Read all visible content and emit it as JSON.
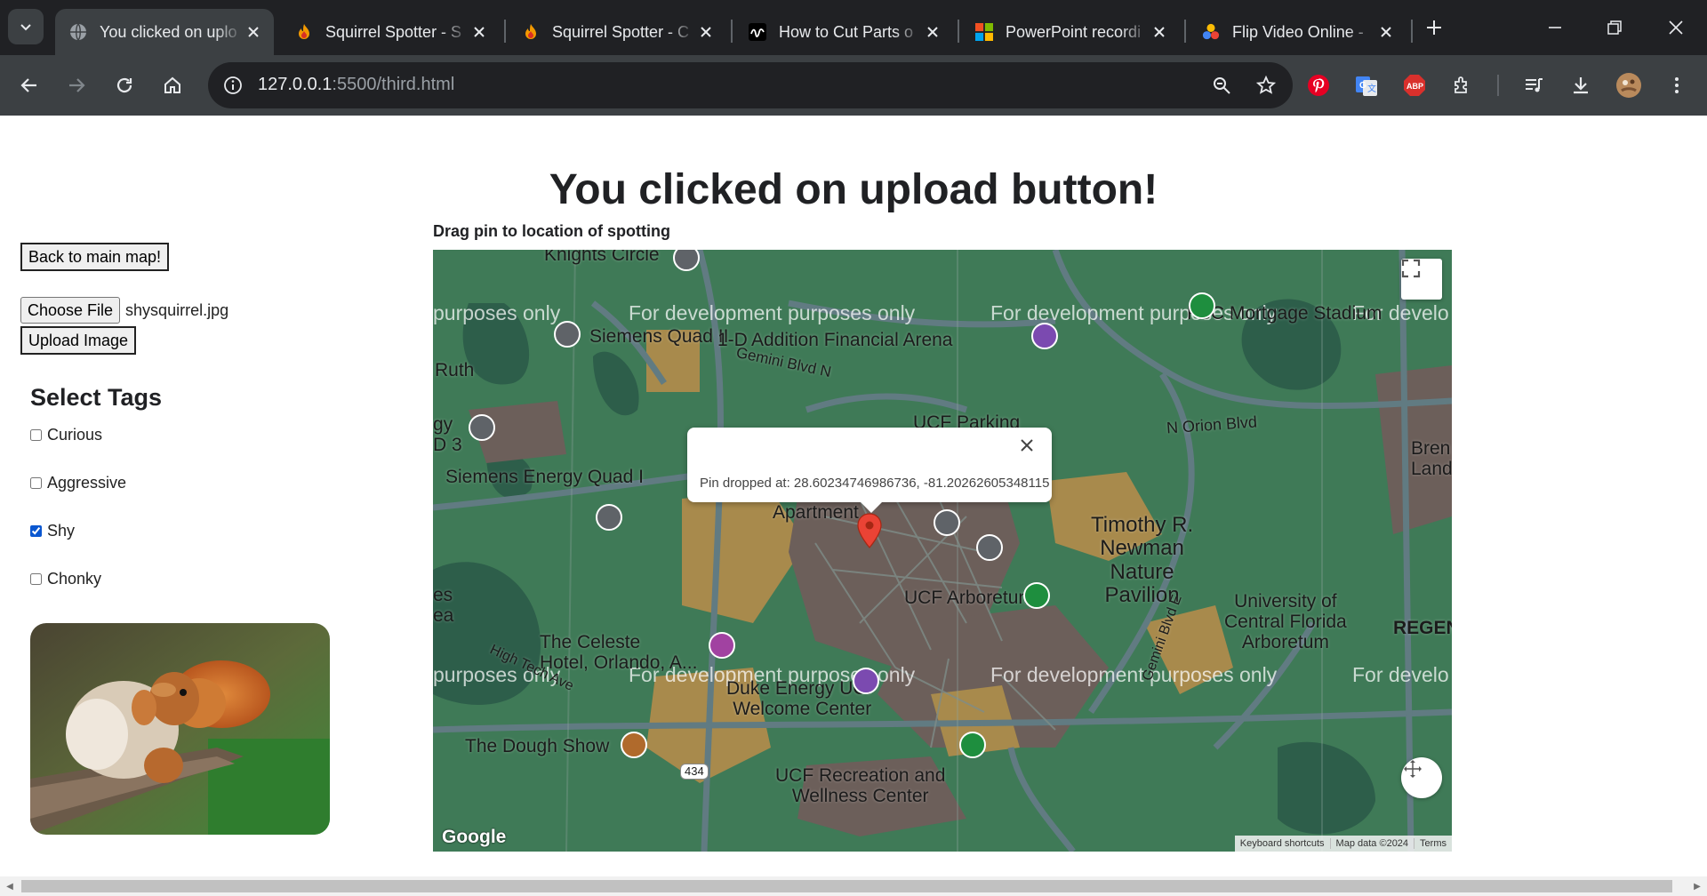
{
  "browser": {
    "tabs": [
      {
        "title": "You clicked on uplo",
        "favicon": "globe-icon",
        "active": true
      },
      {
        "title": "Squirrel Spotter - S",
        "favicon": "flame-icon",
        "active": false
      },
      {
        "title": "Squirrel Spotter - C",
        "favicon": "flame-icon",
        "active": false
      },
      {
        "title": "How to Cut Parts o",
        "favicon": "wave-icon",
        "active": false
      },
      {
        "title": "PowerPoint recordi",
        "favicon": "microsoft-icon",
        "active": false
      },
      {
        "title": "Flip Video Online -",
        "favicon": "dots-icon",
        "active": false
      }
    ],
    "url_host": "127.0.0.1",
    "url_path": ":5500/third.html"
  },
  "page": {
    "heading": "You clicked on upload button!",
    "back_button": "Back to main map!",
    "choose_file_button": "Choose File",
    "file_name": "shysquirrel.jpg",
    "upload_button": "Upload Image",
    "tags_heading": "Select Tags",
    "tags": [
      {
        "label": "Curious",
        "checked": false
      },
      {
        "label": "Aggressive",
        "checked": false
      },
      {
        "label": "Shy",
        "checked": true
      },
      {
        "label": "Chonky",
        "checked": false
      }
    ],
    "drag_label": "Drag pin to location of spotting"
  },
  "map": {
    "watermark": "For development purposes only",
    "watermark_partial_left": "purposes only",
    "watermark_partial_right": "For develo",
    "info_text": "Pin dropped at: 28.60234746986736, -81.20262605348115",
    "labels": {
      "knights": "Knights Circle",
      "siemens2": "Siemens Quad II",
      "addition": "Addition Financial Arena",
      "gemini_n": "Gemini Blvd N",
      "ruth": "Ruth",
      "ucf_parking": "UCF Parking",
      "orion": "N Orion Blvd",
      "siemens_energy": "Siemens Energy Quad I",
      "apartment": "Apartment",
      "timothy": "Timothy R.\nNewman\nNature\nPavilion",
      "arboretum": "UCF Arboretum",
      "ucf_arb": "University of\nCentral Florida\nArboretum",
      "regen": "REGEN",
      "celeste": "The Celeste\nHotel, Orlando, A...",
      "duke": "Duke Energy UCF\nWelcome Center",
      "dough": "The Dough Show",
      "rec": "UCF Recreation and\nWellness Center",
      "route": "434",
      "mortgage": "FBC Mortgage Stadium",
      "brenl": "Bren\nLandin",
      "gemini_e": "Gemini Blvd E",
      "d1": "1-D",
      "gy3": "gy\nD 3",
      "es_ea": "es\nea",
      "high_tech": "High Tech Ave"
    },
    "google": "Google",
    "attribution": [
      "Keyboard shortcuts",
      "Map data ©2024",
      "Terms"
    ]
  }
}
